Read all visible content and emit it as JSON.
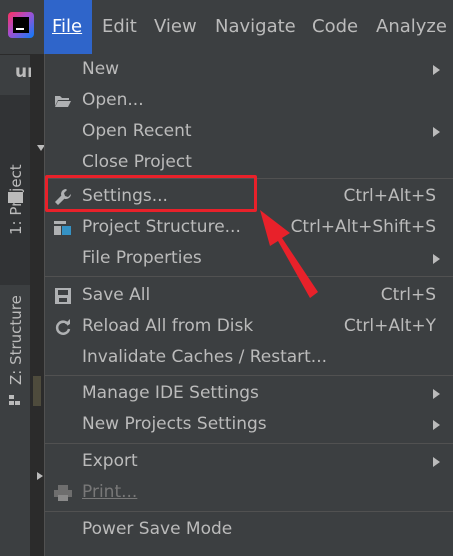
{
  "menubar": {
    "logo_icon": "intellij-idea-logo-icon",
    "items": [
      {
        "label": "File",
        "mnemonic_index": 0,
        "active": true
      },
      {
        "label": "Edit",
        "mnemonic_index": 0
      },
      {
        "label": "View",
        "mnemonic_index": 0
      },
      {
        "label": "Navigate",
        "mnemonic_index": 0
      },
      {
        "label": "Code",
        "mnemonic_index": 0
      },
      {
        "label": "Analyze",
        "mnemonic_index": 5
      }
    ]
  },
  "editor": {
    "tab_fragment": "un"
  },
  "sidebar": {
    "tabs": [
      {
        "label": "1: Project",
        "icon": "folder-icon"
      },
      {
        "label": "Z: Structure",
        "icon": "structure-icon"
      }
    ]
  },
  "file_menu": {
    "items": [
      {
        "label": "New",
        "submenu": true
      },
      {
        "label": "Open...",
        "icon": "folder-open-icon"
      },
      {
        "label": "Open Recent",
        "submenu": true
      },
      {
        "label": "Close Project"
      },
      {
        "label": "Settings...",
        "shortcut": "Ctrl+Alt+S",
        "icon": "wrench-icon",
        "highlighted": true
      },
      {
        "label": "Project Structure...",
        "shortcut": "Ctrl+Alt+Shift+S",
        "icon": "project-structure-icon"
      },
      {
        "label": "File Properties",
        "submenu": true
      },
      {
        "label": "Save All",
        "shortcut": "Ctrl+S",
        "icon": "save-icon"
      },
      {
        "label": "Reload All from Disk",
        "shortcut": "Ctrl+Alt+Y",
        "icon": "reload-icon"
      },
      {
        "label": "Invalidate Caches / Restart..."
      },
      {
        "label": "Manage IDE Settings",
        "submenu": true
      },
      {
        "label": "New Projects Settings",
        "submenu": true
      },
      {
        "label": "Export",
        "submenu": true
      },
      {
        "label": "Print...",
        "icon": "print-icon",
        "disabled": true
      },
      {
        "label": "Power Save Mode"
      }
    ]
  },
  "annotation": {
    "color": "#e8212a"
  }
}
